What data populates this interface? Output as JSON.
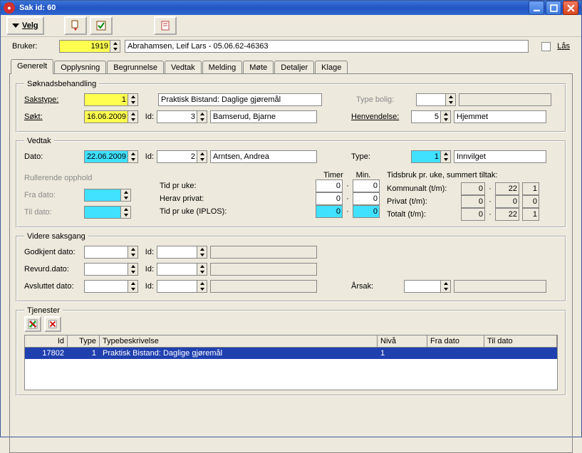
{
  "window": {
    "title": "Sak id: 60"
  },
  "toolbar": {
    "velg_label": "Velg"
  },
  "bruker": {
    "label": "Bruker:",
    "id": "1919",
    "name": "Abrahamsen, Leif Lars - 05.06.62-46363",
    "las_label": "Lås"
  },
  "tabs": [
    "Generelt",
    "Opplysning",
    "Begrunnelse",
    "Vedtak",
    "Melding",
    "Møte",
    "Detaljer",
    "Klage"
  ],
  "soknad": {
    "legend": "Søknadsbehandling",
    "sakstype_label": "Sakstype:",
    "sakstype_val": "1",
    "sakstype_text": "Praktisk Bistand: Daglige gjøremål",
    "typebolig_label": "Type bolig:",
    "typebolig_val": "",
    "typebolig_text": "",
    "sokt_label": "Søkt:",
    "sokt_val": "16.06.2009",
    "sokt_id_label": "Id:",
    "sokt_id_val": "3",
    "sokt_id_text": "Bamserud, Bjarne",
    "henvendelse_label": "Henvendelse:",
    "henvendelse_val": "5",
    "henvendelse_text": "Hjemmet"
  },
  "vedtak": {
    "legend": "Vedtak",
    "dato_label": "Dato:",
    "dato_val": "22.06.2009",
    "id_label": "Id:",
    "id_val": "2",
    "id_text": "Arntsen, Andrea",
    "type_label": "Type:",
    "type_val": "1",
    "type_text": "Innvilget",
    "rullerende_label": "Rullerende opphold",
    "fra_label": "Fra dato:",
    "til_label": "Til dato:",
    "timer_label": "Timer",
    "min_label": "Min.",
    "tidpruke_label": "Tid pr uke:",
    "tidpruke_t": "0",
    "tidpruke_m": "0",
    "heravprivat_label": "Herav privat:",
    "heravprivat_t": "0",
    "heravprivat_m": "0",
    "iplos_label": "Tid pr uke (IPLOS):",
    "iplos_t": "0",
    "iplos_m": "0",
    "tidsbruk_label": "Tidsbruk pr. uke, summert tiltak:",
    "kommunalt_label": "Kommunalt (t/m):",
    "kommunalt_t": "0",
    "kommunalt_m": "22",
    "kommunalt_x": "1",
    "privat_label": "Privat (t/m):",
    "privat_t": "0",
    "privat_m": "0",
    "privat_x": "0",
    "totalt_label": "Totalt (t/m):",
    "totalt_t": "0",
    "totalt_m": "22",
    "totalt_x": "1"
  },
  "videre": {
    "legend": "Videre saksgang",
    "godkjent_label": "Godkjent dato:",
    "revurd_label": "Revurd.dato:",
    "avsluttet_label": "Avsluttet dato:",
    "id_label": "Id:",
    "arsak_label": "Årsak:"
  },
  "tjenester": {
    "legend": "Tjenester",
    "cols": {
      "id": "Id",
      "type": "Type",
      "typeb": "Typebeskrivelse",
      "niva": "Nivå",
      "fra": "Fra dato",
      "til": "Til dato"
    },
    "rows": [
      {
        "id": "17802",
        "type": "1",
        "typeb": "Praktisk Bistand: Daglige gjøremål",
        "niva": "1",
        "fra": "",
        "til": ""
      }
    ]
  }
}
